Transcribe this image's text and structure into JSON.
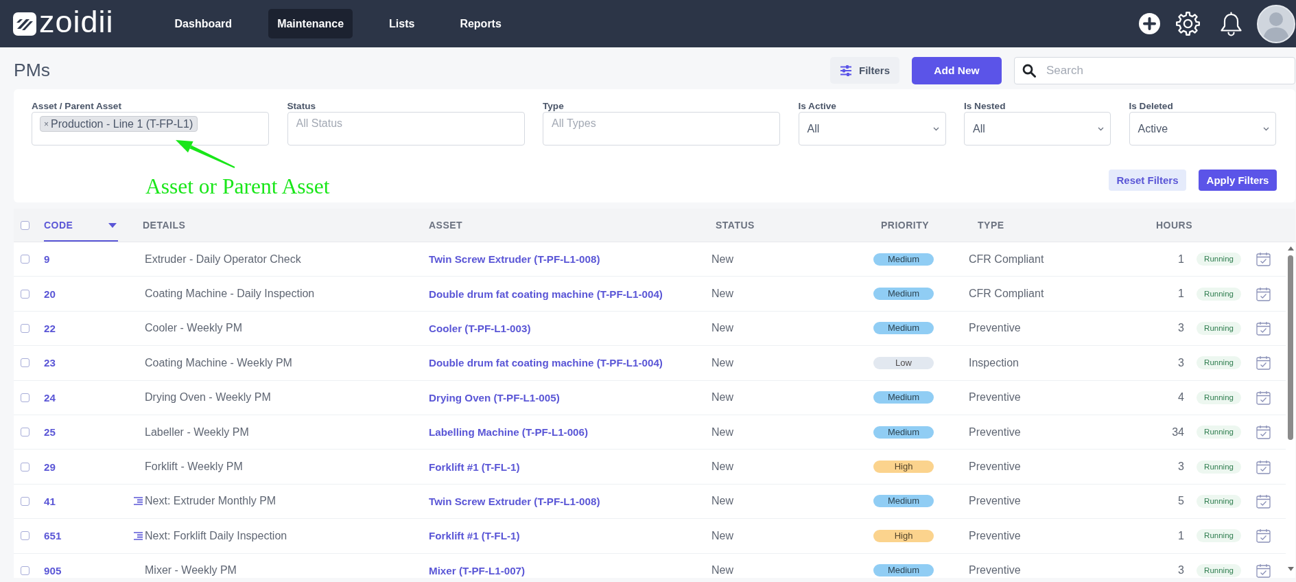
{
  "nav": {
    "logo": "zoidii",
    "items": [
      {
        "label": "Dashboard",
        "selected": false
      },
      {
        "label": "Maintenance",
        "selected": true
      },
      {
        "label": "Lists",
        "selected": false
      },
      {
        "label": "Reports",
        "selected": false
      }
    ]
  },
  "toolbar": {
    "title": "PMs",
    "filters_button": "Filters",
    "add_button": "Add New",
    "search": {
      "placeholder": "Search"
    }
  },
  "filters": {
    "fields": [
      {
        "kind": "multiselect",
        "label": "Asset / Parent Asset",
        "chips": [
          {
            "remove": "×",
            "label": "Production - Line 1 (T-FP-L1)"
          }
        ]
      },
      {
        "kind": "multiselect",
        "label": "Status",
        "placeholder": "All Status"
      },
      {
        "kind": "multiselect",
        "label": "Type",
        "placeholder": "All Types"
      },
      {
        "kind": "select",
        "label": "Is Active",
        "value": "All"
      },
      {
        "kind": "select",
        "label": "Is Nested",
        "value": "All"
      },
      {
        "kind": "select",
        "label": "Is Deleted",
        "value": "Active"
      }
    ],
    "annotation": "Asset or Parent Asset",
    "reset_button": "Reset Filters",
    "apply_button": "Apply Filters"
  },
  "table": {
    "all_checked": false,
    "columns": [
      {
        "label": "CODE",
        "selected": true
      },
      {
        "label": "DETAILS",
        "selected": false
      },
      {
        "label": "ASSET",
        "selected": false
      },
      {
        "label": "STATUS",
        "selected": false
      },
      {
        "label": "PRIORITY",
        "selected": false
      },
      {
        "label": "TYPE",
        "selected": false
      },
      {
        "label": "HOURS",
        "selected": false
      }
    ],
    "rows": [
      {
        "checked": false,
        "code": "9",
        "nested": false,
        "details": "Extruder - Daily Operator Check",
        "asset": "Twin Screw Extruder (T-PF-L1-008)",
        "status": "New",
        "priority": {
          "label": "Medium",
          "color": "#90cdf4"
        },
        "type": "CFR Compliant",
        "hours": "1",
        "state": "Running"
      },
      {
        "checked": false,
        "code": "20",
        "nested": false,
        "details": "Coating Machine - Daily Inspection",
        "asset": "Double drum fat coating machine (T-PF-L1-004)",
        "status": "New",
        "priority": {
          "label": "Medium",
          "color": "#90cdf4"
        },
        "type": "CFR Compliant",
        "hours": "1",
        "state": "Running"
      },
      {
        "checked": false,
        "code": "22",
        "nested": false,
        "details": "Cooler - Weekly PM",
        "asset": "Cooler (T-PF-L1-003)",
        "status": "New",
        "priority": {
          "label": "Medium",
          "color": "#90cdf4"
        },
        "type": "Preventive",
        "hours": "3",
        "state": "Running"
      },
      {
        "checked": false,
        "code": "23",
        "nested": false,
        "details": "Coating Machine - Weekly PM",
        "asset": "Double drum fat coating machine (T-PF-L1-004)",
        "status": "New",
        "priority": {
          "label": "Low",
          "color": "#e2e8f0"
        },
        "type": "Inspection",
        "hours": "3",
        "state": "Running"
      },
      {
        "checked": false,
        "code": "24",
        "nested": false,
        "details": "Drying Oven - Weekly PM",
        "asset": "Drying Oven (T-PF-L1-005)",
        "status": "New",
        "priority": {
          "label": "Medium",
          "color": "#90cdf4"
        },
        "type": "Preventive",
        "hours": "4",
        "state": "Running"
      },
      {
        "checked": false,
        "code": "25",
        "nested": false,
        "details": "Labeller - Weekly PM",
        "asset": "Labelling Machine (T-PF-L1-006)",
        "status": "New",
        "priority": {
          "label": "Medium",
          "color": "#90cdf4"
        },
        "type": "Preventive",
        "hours": "34",
        "state": "Running"
      },
      {
        "checked": false,
        "code": "29",
        "nested": false,
        "details": "Forklift - Weekly PM",
        "asset": "Forklift #1 (T-FL-1)",
        "status": "New",
        "priority": {
          "label": "High",
          "color": "#fbd38d"
        },
        "type": "Preventive",
        "hours": "3",
        "state": "Running"
      },
      {
        "checked": false,
        "code": "41",
        "nested": true,
        "details": "Next: Extruder Monthly PM",
        "asset": "Twin Screw Extruder (T-PF-L1-008)",
        "status": "New",
        "priority": {
          "label": "Medium",
          "color": "#90cdf4"
        },
        "type": "Preventive",
        "hours": "5",
        "state": "Running"
      },
      {
        "checked": false,
        "code": "651",
        "nested": true,
        "details": "Next: Forklift Daily Inspection",
        "asset": "Forklift #1 (T-FL-1)",
        "status": "New",
        "priority": {
          "label": "High",
          "color": "#fbd38d"
        },
        "type": "Preventive",
        "hours": "1",
        "state": "Running"
      },
      {
        "checked": false,
        "code": "905",
        "nested": false,
        "details": "Mixer - Weekly PM",
        "asset": "Mixer (T-PF-L1-007)",
        "status": "New",
        "priority": {
          "label": "Medium",
          "color": "#90cdf4"
        },
        "type": "Preventive",
        "hours": "3",
        "state": "Running"
      }
    ]
  }
}
